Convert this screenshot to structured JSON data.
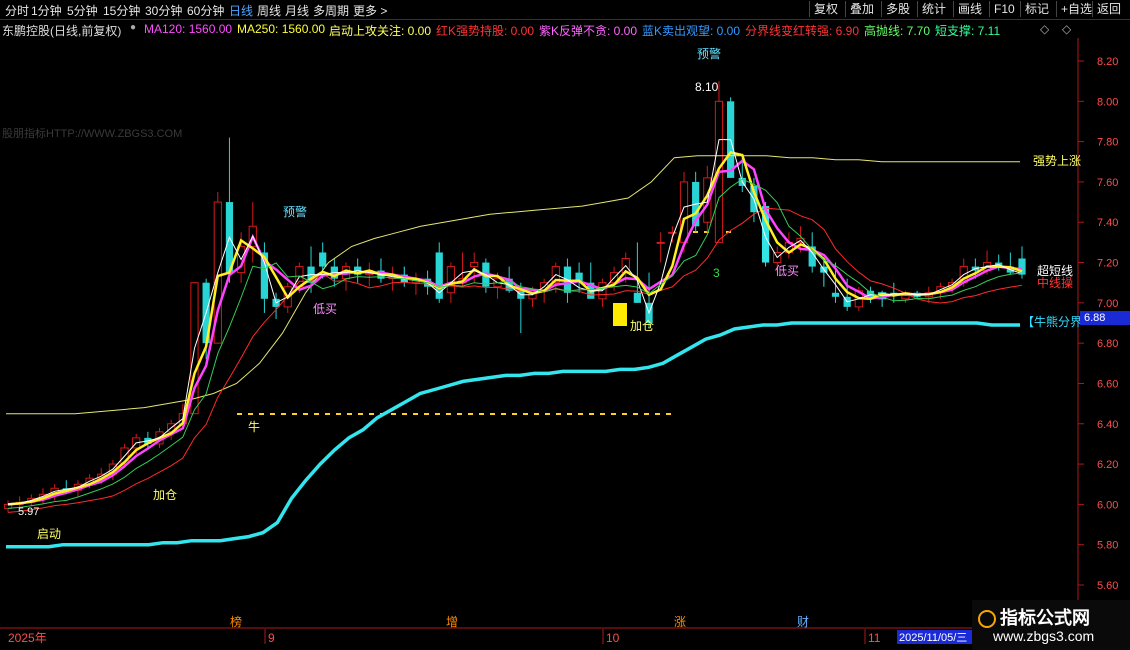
{
  "toolbar": {
    "periods": [
      "分时",
      "1分钟",
      "5分钟",
      "15分钟",
      "30分钟",
      "60分钟",
      "日线",
      "周线",
      "月线",
      "多周期",
      "更多 >"
    ],
    "active_period": "日线",
    "right_buttons": [
      "复权",
      "叠加",
      "多股",
      "统计",
      "画线",
      "F10",
      "标记",
      "+自选",
      "返回"
    ]
  },
  "info": {
    "stock_title": "东鹏控股(日线,前复权)",
    "ma120": "MA120: 1560.00",
    "ma250": "MA250: 1560.00",
    "start_focus": "启动上攻关注: 0.00",
    "red_k": "红K强势持股: 0.00",
    "purple_k": "紫K反弹不贪: 0.00",
    "blue_k": "蓝K卖出观望: 0.00",
    "divide_line": "分界线变红转强: 6.90",
    "high_throw": "高抛线: 7.70",
    "short_support": "短支撑: 7.11",
    "diamond_icon": "diamond-icon",
    "colors": {
      "ma120": "#ff4dff",
      "ma250": "#ffff33",
      "start": "#ffff66",
      "red": "#ff3333",
      "purple": "#ff66ff",
      "blue": "#3399ff",
      "divide": "#ff3333",
      "high": "#66ff66",
      "short": "#33ff99"
    }
  },
  "watermark_text": "股朋指标HTTP://WWW.ZBGS3.COM",
  "y_axis": [
    "8.20",
    "8.00",
    "7.80",
    "7.60",
    "7.40",
    "7.20",
    "7.00",
    "6.80",
    "6.60",
    "6.40",
    "6.20",
    "6.00",
    "5.80",
    "5.60"
  ],
  "current_price": "6.88",
  "annotations": {
    "yujing_top": "预警",
    "yujing_left": "预警",
    "high_label": "8.10",
    "low_label": "5.97",
    "qidong": "启动",
    "jiacang1": "加仓",
    "jiacang2": "加仓",
    "niu": "牛",
    "dimai1": "低买",
    "dimai2": "低买",
    "three": "3",
    "qiangshi": "强势上涨",
    "chaoduan": "超短线",
    "zhongxian": "中线操",
    "niuxiong": "【牛熊分界"
  },
  "x_axis": {
    "year": "2025年",
    "m9": "9",
    "m10": "10",
    "m11": "11",
    "date": "2025/11/05/三"
  },
  "events": [
    "榜",
    "增",
    "涨",
    "财"
  ],
  "logo": {
    "name": "指标公式网",
    "url": "www.zbgs3.com"
  },
  "chart_data": {
    "type": "candlestick",
    "ylim": [
      5.6,
      8.25
    ],
    "ohlc": [
      [
        5.98,
        6.02,
        5.96,
        6.0
      ],
      [
        6.0,
        6.04,
        5.98,
        6.01
      ],
      [
        6.01,
        6.05,
        5.99,
        6.03
      ],
      [
        6.03,
        6.08,
        6.0,
        6.05
      ],
      [
        6.05,
        6.1,
        6.02,
        6.08
      ],
      [
        6.08,
        6.12,
        6.05,
        6.07
      ],
      [
        6.07,
        6.12,
        6.04,
        6.1
      ],
      [
        6.1,
        6.15,
        6.08,
        6.13
      ],
      [
        6.13,
        6.18,
        6.1,
        6.15
      ],
      [
        6.15,
        6.22,
        6.12,
        6.2
      ],
      [
        6.2,
        6.3,
        6.18,
        6.28
      ],
      [
        6.28,
        6.35,
        6.25,
        6.33
      ],
      [
        6.33,
        6.36,
        6.28,
        6.3
      ],
      [
        6.3,
        6.38,
        6.28,
        6.36
      ],
      [
        6.36,
        6.42,
        6.32,
        6.4
      ],
      [
        6.4,
        6.5,
        6.38,
        6.45
      ],
      [
        6.45,
        7.08,
        6.72,
        7.1
      ],
      [
        7.1,
        7.12,
        6.72,
        6.8
      ],
      [
        6.8,
        7.55,
        6.85,
        7.5
      ],
      [
        7.5,
        7.82,
        7.1,
        7.15
      ],
      [
        7.15,
        7.35,
        7.1,
        7.28
      ],
      [
        7.28,
        7.5,
        7.2,
        7.38
      ],
      [
        7.25,
        7.3,
        6.95,
        7.02
      ],
      [
        7.02,
        7.05,
        6.92,
        6.98
      ],
      [
        6.98,
        7.1,
        6.95,
        7.08
      ],
      [
        7.08,
        7.2,
        7.05,
        7.18
      ],
      [
        7.18,
        7.28,
        7.05,
        7.1
      ],
      [
        7.25,
        7.3,
        7.12,
        7.18
      ],
      [
        7.18,
        7.22,
        7.08,
        7.12
      ],
      [
        7.12,
        7.2,
        7.06,
        7.18
      ],
      [
        7.18,
        7.22,
        7.1,
        7.14
      ],
      [
        7.14,
        7.2,
        7.08,
        7.16
      ],
      [
        7.16,
        7.22,
        7.1,
        7.12
      ],
      [
        7.12,
        7.18,
        7.06,
        7.14
      ],
      [
        7.14,
        7.18,
        7.08,
        7.1
      ],
      [
        7.1,
        7.15,
        7.04,
        7.12
      ],
      [
        7.12,
        7.16,
        7.04,
        7.08
      ],
      [
        7.25,
        7.3,
        7.0,
        7.02
      ],
      [
        7.05,
        7.2,
        7.0,
        7.18
      ],
      [
        7.1,
        7.25,
        7.08,
        7.12
      ],
      [
        7.18,
        7.25,
        7.1,
        7.2
      ],
      [
        7.2,
        7.22,
        7.05,
        7.08
      ],
      [
        7.08,
        7.15,
        7.02,
        7.12
      ],
      [
        7.12,
        7.18,
        7.05,
        7.06
      ],
      [
        7.06,
        7.1,
        6.85,
        7.02
      ],
      [
        7.02,
        7.08,
        6.98,
        7.06
      ],
      [
        7.06,
        7.12,
        7.0,
        7.1
      ],
      [
        7.1,
        7.2,
        7.05,
        7.18
      ],
      [
        7.18,
        7.22,
        7.0,
        7.05
      ],
      [
        7.15,
        7.2,
        7.05,
        7.1
      ],
      [
        7.1,
        7.2,
        7.05,
        7.02
      ],
      [
        7.02,
        7.12,
        6.98,
        7.1
      ],
      [
        7.1,
        7.18,
        7.06,
        7.15
      ],
      [
        7.15,
        7.25,
        7.1,
        7.22
      ],
      [
        7.05,
        7.3,
        7.0,
        7.0
      ],
      [
        7.0,
        7.15,
        6.88,
        6.9
      ],
      [
        7.3,
        7.35,
        7.2,
        7.3
      ],
      [
        7.35,
        7.38,
        7.3,
        7.35
      ],
      [
        7.3,
        7.65,
        7.25,
        7.6
      ],
      [
        7.6,
        7.65,
        7.35,
        7.38
      ],
      [
        7.4,
        7.68,
        7.35,
        7.62
      ],
      [
        7.3,
        8.1,
        7.3,
        8.0
      ],
      [
        8.0,
        8.02,
        7.62,
        7.62
      ],
      [
        7.62,
        7.72,
        7.55,
        7.58
      ],
      [
        7.58,
        7.62,
        7.4,
        7.45
      ],
      [
        7.48,
        7.5,
        7.18,
        7.2
      ],
      [
        7.2,
        7.28,
        7.15,
        7.25
      ],
      [
        7.25,
        7.35,
        7.22,
        7.3
      ],
      [
        7.3,
        7.38,
        7.25,
        7.32
      ],
      [
        7.28,
        7.35,
        7.15,
        7.18
      ],
      [
        7.18,
        7.22,
        7.08,
        7.15
      ],
      [
        7.05,
        7.2,
        7.0,
        7.03
      ],
      [
        7.03,
        7.12,
        6.96,
        6.98
      ],
      [
        6.98,
        7.08,
        6.96,
        7.06
      ],
      [
        7.06,
        7.08,
        7.0,
        7.02
      ],
      [
        7.02,
        7.06,
        6.98,
        7.05
      ],
      [
        7.05,
        7.1,
        7.0,
        7.04
      ],
      [
        7.02,
        7.06,
        7.0,
        7.05
      ],
      [
        7.05,
        7.06,
        7.02,
        7.03
      ],
      [
        7.03,
        7.08,
        7.0,
        7.05
      ],
      [
        7.05,
        7.1,
        7.02,
        7.08
      ],
      [
        7.08,
        7.12,
        7.05,
        7.1
      ],
      [
        7.1,
        7.22,
        7.08,
        7.18
      ],
      [
        7.18,
        7.22,
        7.12,
        7.16
      ],
      [
        7.16,
        7.26,
        7.14,
        7.2
      ],
      [
        7.2,
        7.24,
        7.16,
        7.18
      ],
      [
        7.18,
        7.25,
        7.14,
        7.15
      ],
      [
        7.22,
        7.28,
        7.12,
        7.14
      ]
    ],
    "bull_bear_line": [
      5.79,
      5.79,
      5.79,
      5.79,
      5.8,
      5.8,
      5.8,
      5.8,
      5.8,
      5.8,
      5.8,
      5.81,
      5.81,
      5.82,
      5.82,
      5.82,
      5.83,
      5.84,
      5.86,
      5.91,
      6.03,
      6.12,
      6.2,
      6.27,
      6.33,
      6.37,
      6.43,
      6.47,
      6.51,
      6.55,
      6.57,
      6.59,
      6.61,
      6.62,
      6.63,
      6.64,
      6.64,
      6.65,
      6.65,
      6.66,
      6.66,
      6.66,
      6.66,
      6.67,
      6.67,
      6.68,
      6.7,
      6.74,
      6.78,
      6.82,
      6.84,
      6.87,
      6.88,
      6.89,
      6.89,
      6.9,
      6.9,
      6.9,
      6.9,
      6.9,
      6.9,
      6.9,
      6.9,
      6.9,
      6.9,
      6.9,
      6.9,
      6.9,
      6.9,
      6.89,
      6.89,
      6.89
    ],
    "upper_band": [
      6.45,
      6.45,
      6.45,
      6.45,
      6.46,
      6.47,
      6.48,
      6.5,
      6.52,
      6.55,
      6.6,
      6.7,
      6.85,
      7.05,
      7.2,
      7.28,
      7.32,
      7.35,
      7.38,
      7.4,
      7.42,
      7.44,
      7.45,
      7.46,
      7.47,
      7.48,
      7.5,
      7.52,
      7.6,
      7.72,
      7.73,
      7.73,
      7.73,
      7.73,
      7.72,
      7.72,
      7.71,
      7.71,
      7.7,
      7.7,
      7.7,
      7.7,
      7.7,
      7.7,
      7.7
    ]
  }
}
